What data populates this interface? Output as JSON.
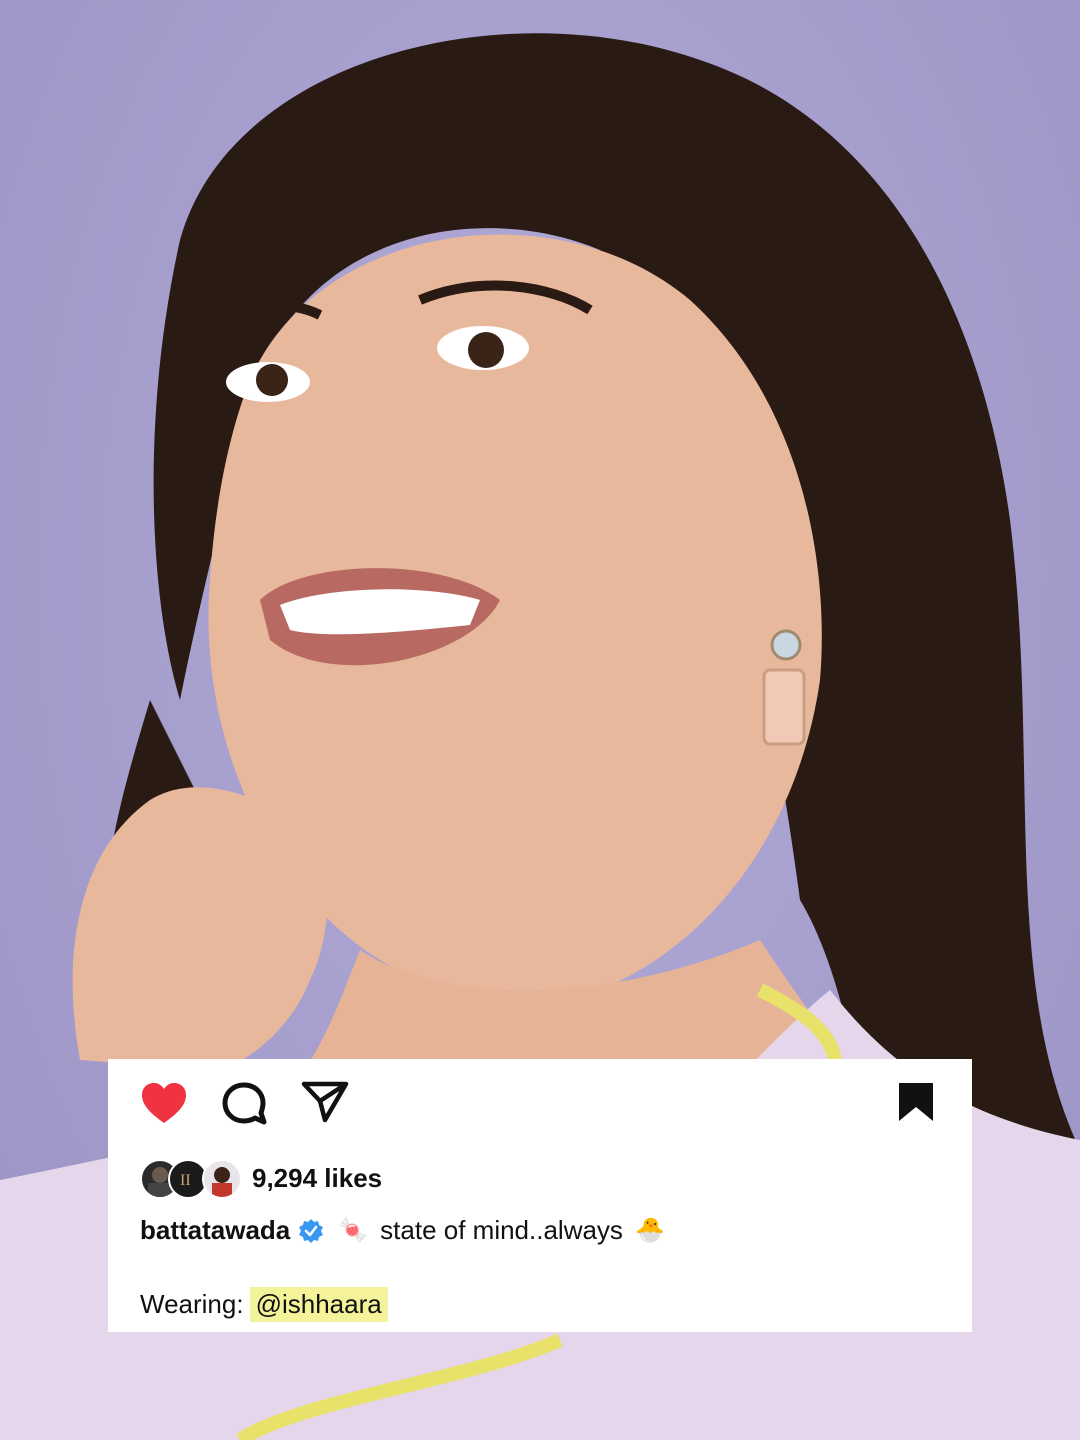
{
  "post": {
    "likes": "9,294 likes",
    "username": "battatawada",
    "caption_emoji": "🍬",
    "caption": "state of mind..always",
    "caption_emoji_end": "🐣",
    "wearing_label": "Wearing:",
    "mention": "@ishhaara"
  },
  "icons": {
    "like": "heart-icon",
    "comment": "comment-icon",
    "share": "send-icon",
    "save": "bookmark-icon",
    "verified": "verified-badge-icon"
  },
  "colors": {
    "heart": "#ef3340",
    "background": "#a7a0cf",
    "mention_highlight": "#f4f39a",
    "verified": "#3897f0"
  }
}
